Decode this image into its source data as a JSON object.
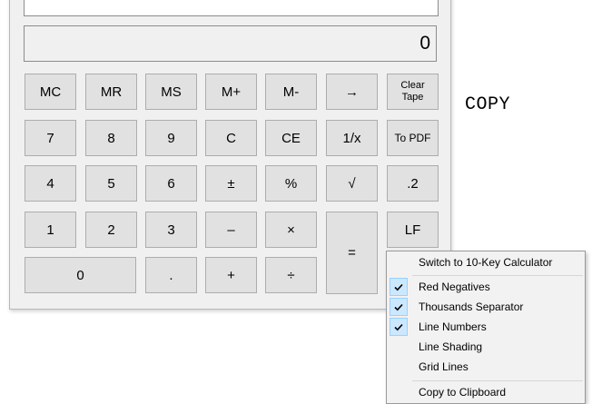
{
  "display": {
    "value": "0"
  },
  "keypad": {
    "row1": [
      "MC",
      "MR",
      "MS",
      "M+",
      "M-",
      "→"
    ],
    "clear_tape": "Clear\nTape",
    "to_pdf": "To PDF",
    "row2": [
      "7",
      "8",
      "9",
      "C",
      "CE",
      "1/x"
    ],
    "row3": [
      "4",
      "5",
      "6",
      "±",
      "%",
      "√",
      ".2"
    ],
    "row4": [
      "1",
      "2",
      "3",
      "–",
      "×"
    ],
    "equals": "=",
    "lf": "LF",
    "row5": [
      "0",
      ".",
      "+",
      "÷"
    ]
  },
  "overlay": {
    "copy": "COPY"
  },
  "context_menu": {
    "switch": "Switch to 10-Key Calculator",
    "red_negatives": "Red Negatives",
    "thousands_separator": "Thousands Separator",
    "line_numbers": "Line Numbers",
    "line_shading": "Line Shading",
    "grid_lines": "Grid Lines",
    "copy_clipboard": "Copy to Clipboard",
    "checked": {
      "red_negatives": true,
      "thousands_separator": true,
      "line_numbers": true,
      "line_shading": false,
      "grid_lines": false
    }
  },
  "colors": {
    "check_bg": "#cce8ff",
    "check_border": "#99d1ff",
    "key_bg": "#e1e1e1"
  }
}
